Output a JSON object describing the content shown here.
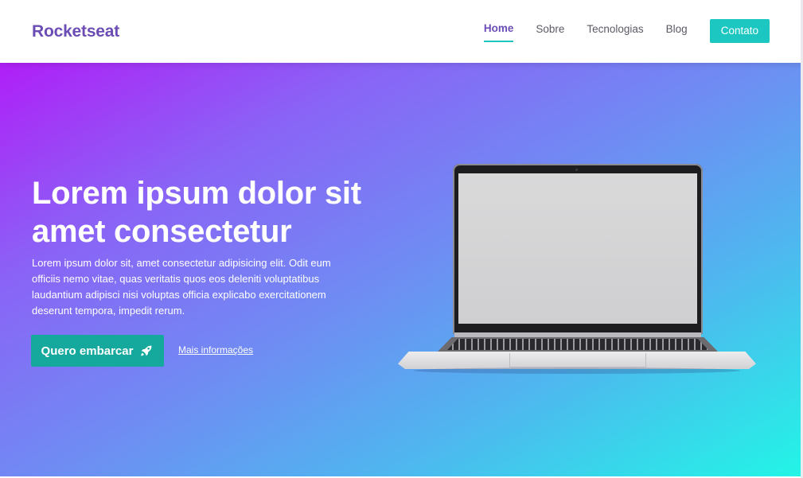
{
  "header": {
    "logo": "Rocketseat",
    "nav": {
      "home": "Home",
      "about": "Sobre",
      "technologies": "Tecnologias",
      "blog": "Blog",
      "contact": "Contato"
    }
  },
  "hero": {
    "title": "Lorem ipsum dolor sit amet consectetur",
    "text": "Lorem ipsum dolor sit, amet consectetur adipisicing elit. Odit eum officiis nemo vitae, quas veritatis quos eos deleniti voluptatibus laudantium adipisci nisi voluptas officia explicabo exercitationem deserunt tempora, impedit rerum.",
    "cta_label": "Quero embarcar",
    "cta_icon": "rocket-icon",
    "more_link": "Mais informações"
  },
  "colors": {
    "brand": "#6c4db5",
    "accent": "#1cc7c2",
    "cta": "#15a99d",
    "gradient_start": "#b01ef7",
    "gradient_end": "#22f5e6"
  }
}
